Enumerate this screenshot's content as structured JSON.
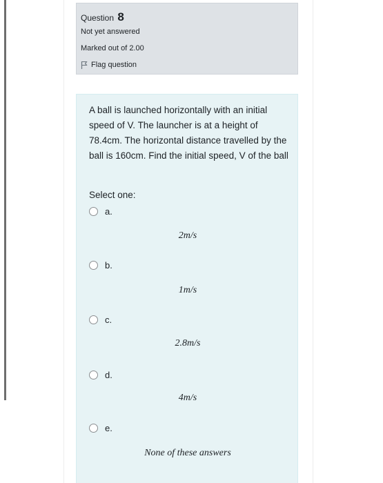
{
  "question": {
    "label": "Question",
    "number": "8",
    "state": "Not yet answered",
    "marks": "Marked out of 2.00",
    "flag_label": "Flag question"
  },
  "question_text": "A ball is launched horizontally with an initial speed of V. The launcher is at a height of 78.4cm. The horizontal distance travelled by the ball is 160cm. Find the initial speed, V of the ball",
  "prompt": "Select one:",
  "options": [
    {
      "letter": "a.",
      "value": "2m/s"
    },
    {
      "letter": "b.",
      "value": "1m/s"
    },
    {
      "letter": "c.",
      "value": "2.8m/s"
    },
    {
      "letter": "d.",
      "value": "4m/s"
    },
    {
      "letter": "e.",
      "value": "None of these answers"
    }
  ],
  "icons": {
    "flag": "flag-icon",
    "radio": "radio-button"
  }
}
